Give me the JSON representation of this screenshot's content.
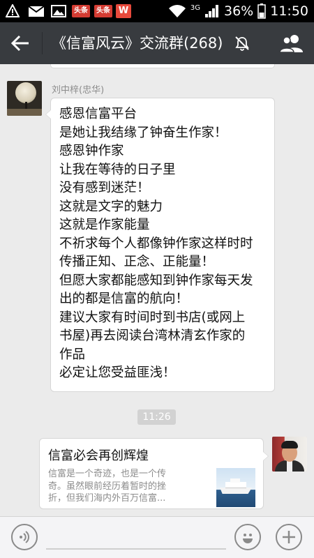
{
  "status_bar": {
    "notification_icons": [
      "warning-icon",
      "mail-icon",
      "image-icon",
      "toutiao-app-icon",
      "toutiao-app-icon",
      "wps-app-icon"
    ],
    "toutiao_label": "头条",
    "wps_label": "W",
    "network": "3G",
    "battery": "36%",
    "time": "11:50"
  },
  "title_bar": {
    "title": "《信富风云》交流群(268)",
    "icons": [
      "back-arrow-icon",
      "mute-bell-icon",
      "group-members-icon"
    ]
  },
  "message_left": {
    "sender": "刘中梓(忠华)",
    "lines": [
      "感恩信富平台",
      "是她让我结缘了钟奋生作家！",
      "感恩钟作家",
      "让我在等待的日子里",
      "没有感到迷茫！",
      "这就是文字的魅力",
      "这就是作家能量",
      "不祈求每个人都像钟作家这样时时",
      "传播正知、正念、正能量！",
      "但愿大家都能感知到钟作家每天发",
      "出的都是信富的航向！",
      "建议大家有时间时到书店(或网上",
      "书屋)再去阅读台湾林清玄作家的",
      "作品",
      "必定让您受益匪浅！"
    ]
  },
  "timestamp": "11:26",
  "message_right": {
    "card_title": "信富必会再创辉煌",
    "card_desc_lines": [
      "信富是一个奇迹，也是一个传",
      "奇。虽然眼前经历着暂时的挫",
      "折，但我们海内外百万信富..."
    ]
  },
  "input_bar": {
    "icons": [
      "voice-icon",
      "emoji-icon",
      "plus-icon"
    ]
  }
}
